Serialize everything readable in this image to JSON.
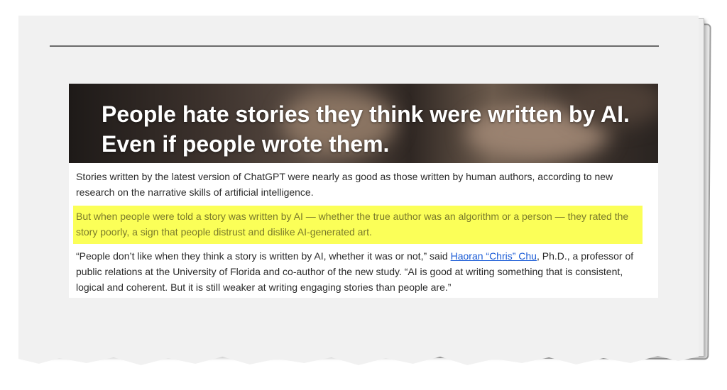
{
  "headline": "People hate stories they think were written by AI. Even if people wrote them.",
  "paragraph1": "Stories written by the latest version of ChatGPT were nearly as good as those written by human authors, according to new research on the narrative skills of artificial intelligence.",
  "paragraph2_highlighted": "But when people were told a story was written by AI — whether the true author was an algorithm or a person — they rated the story poorly, a sign that people distrust and dislike AI-generated art.",
  "paragraph3": {
    "before": "“People don’t like when they think a story is written by AI, whether it was or not,” said ",
    "link_text": "Haoran “Chris” Chu",
    "after": ", Ph.D., a professor of public relations at the University of Florida and co-author of the new study. “AI is good at writing something that is consistent, logical and coherent. But it is still weaker at writing engaging stories than people are.”"
  },
  "colors": {
    "highlight": "#fbff58",
    "link": "#1a5bd6",
    "paper": "#f1f1f1"
  }
}
